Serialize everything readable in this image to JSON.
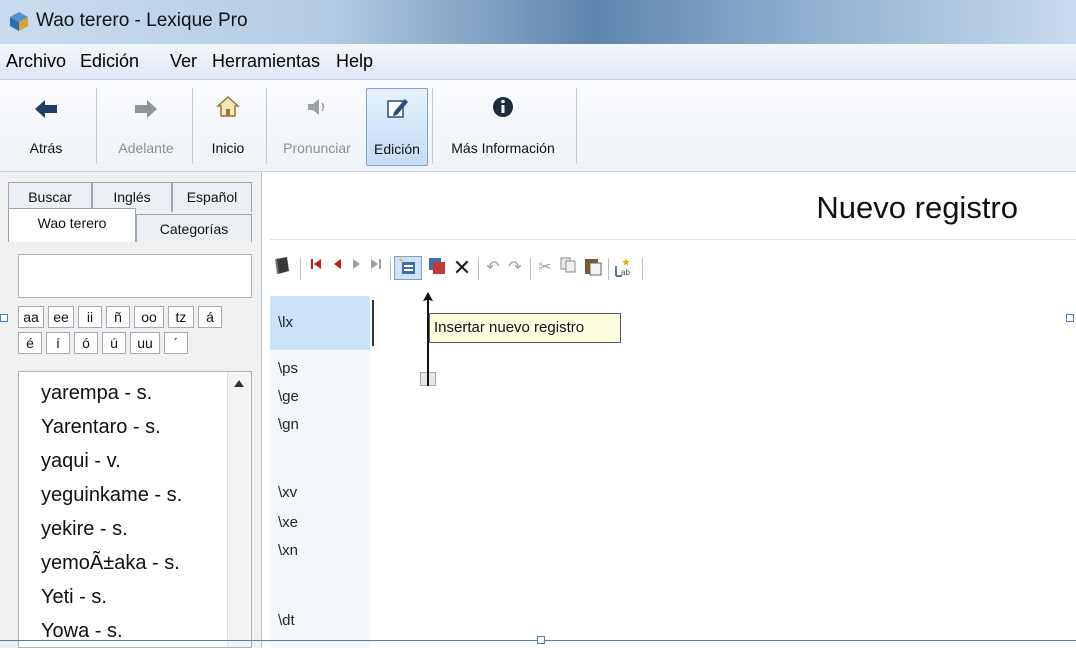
{
  "window": {
    "title": "Wao terero - Lexique Pro",
    "icon": "lexique-app-icon"
  },
  "menu": {
    "items": [
      "Archivo",
      "Edición",
      "Ver",
      "Herramientas",
      "Help"
    ]
  },
  "toolbar": {
    "buttons": [
      {
        "label": "Atrás",
        "icon": "arrow-left-icon",
        "enabled": true
      },
      {
        "label": "Adelante",
        "icon": "arrow-right-icon",
        "enabled": false
      },
      {
        "label": "Inicio",
        "icon": "home-icon",
        "enabled": true
      },
      {
        "label": "Pronunciar",
        "icon": "speaker-icon",
        "enabled": false
      },
      {
        "label": "Edición",
        "icon": "edit-icon",
        "enabled": true,
        "active": true
      },
      {
        "label": "Más Información",
        "icon": "info-icon",
        "enabled": true
      }
    ]
  },
  "left": {
    "tabs_row1": [
      "Buscar",
      "Inglés",
      "Español"
    ],
    "tabs_row2": [
      "Wao terero",
      "Categorías"
    ],
    "selected_tab": "Wao terero",
    "search_value": "",
    "chars_row1": [
      "aa",
      "ee",
      "ii",
      "ñ",
      "oo",
      "tz",
      "á"
    ],
    "chars_row2": [
      "é",
      "í",
      "ó",
      "ú",
      "uu",
      "´"
    ],
    "words": [
      "yarempa - s.",
      "Yarentaro - s.",
      "yaqui - v.",
      "yeguinkame - s.",
      "yekire - s.",
      "yemoÃ±aka - s.",
      "Yeti - s.",
      "Yowa - s."
    ]
  },
  "record": {
    "title": "Nuevo registro"
  },
  "edit_toolbar": {
    "icons": [
      "book-icon",
      "first-record-icon",
      "prev-record-icon",
      "next-record-icon",
      "last-record-icon",
      "insert-record-icon",
      "duplicate-record-icon",
      "delete-record-icon",
      "undo-icon",
      "redo-icon",
      "cut-icon",
      "copy-icon",
      "paste-icon",
      "sort-icon"
    ]
  },
  "fields": {
    "markers": [
      "\\lx",
      "\\ps",
      "\\ge",
      "\\gn",
      "\\xv",
      "\\xe",
      "\\xn",
      "\\dt"
    ],
    "selected": "\\lx"
  },
  "tooltip": {
    "text": "Insertar nuevo registro"
  },
  "colors": {
    "active_button": "#c5ddf5",
    "selected_marker": "#cbe3fa",
    "tooltip_bg": "#fffde0",
    "nav_red": "#c0201a"
  }
}
